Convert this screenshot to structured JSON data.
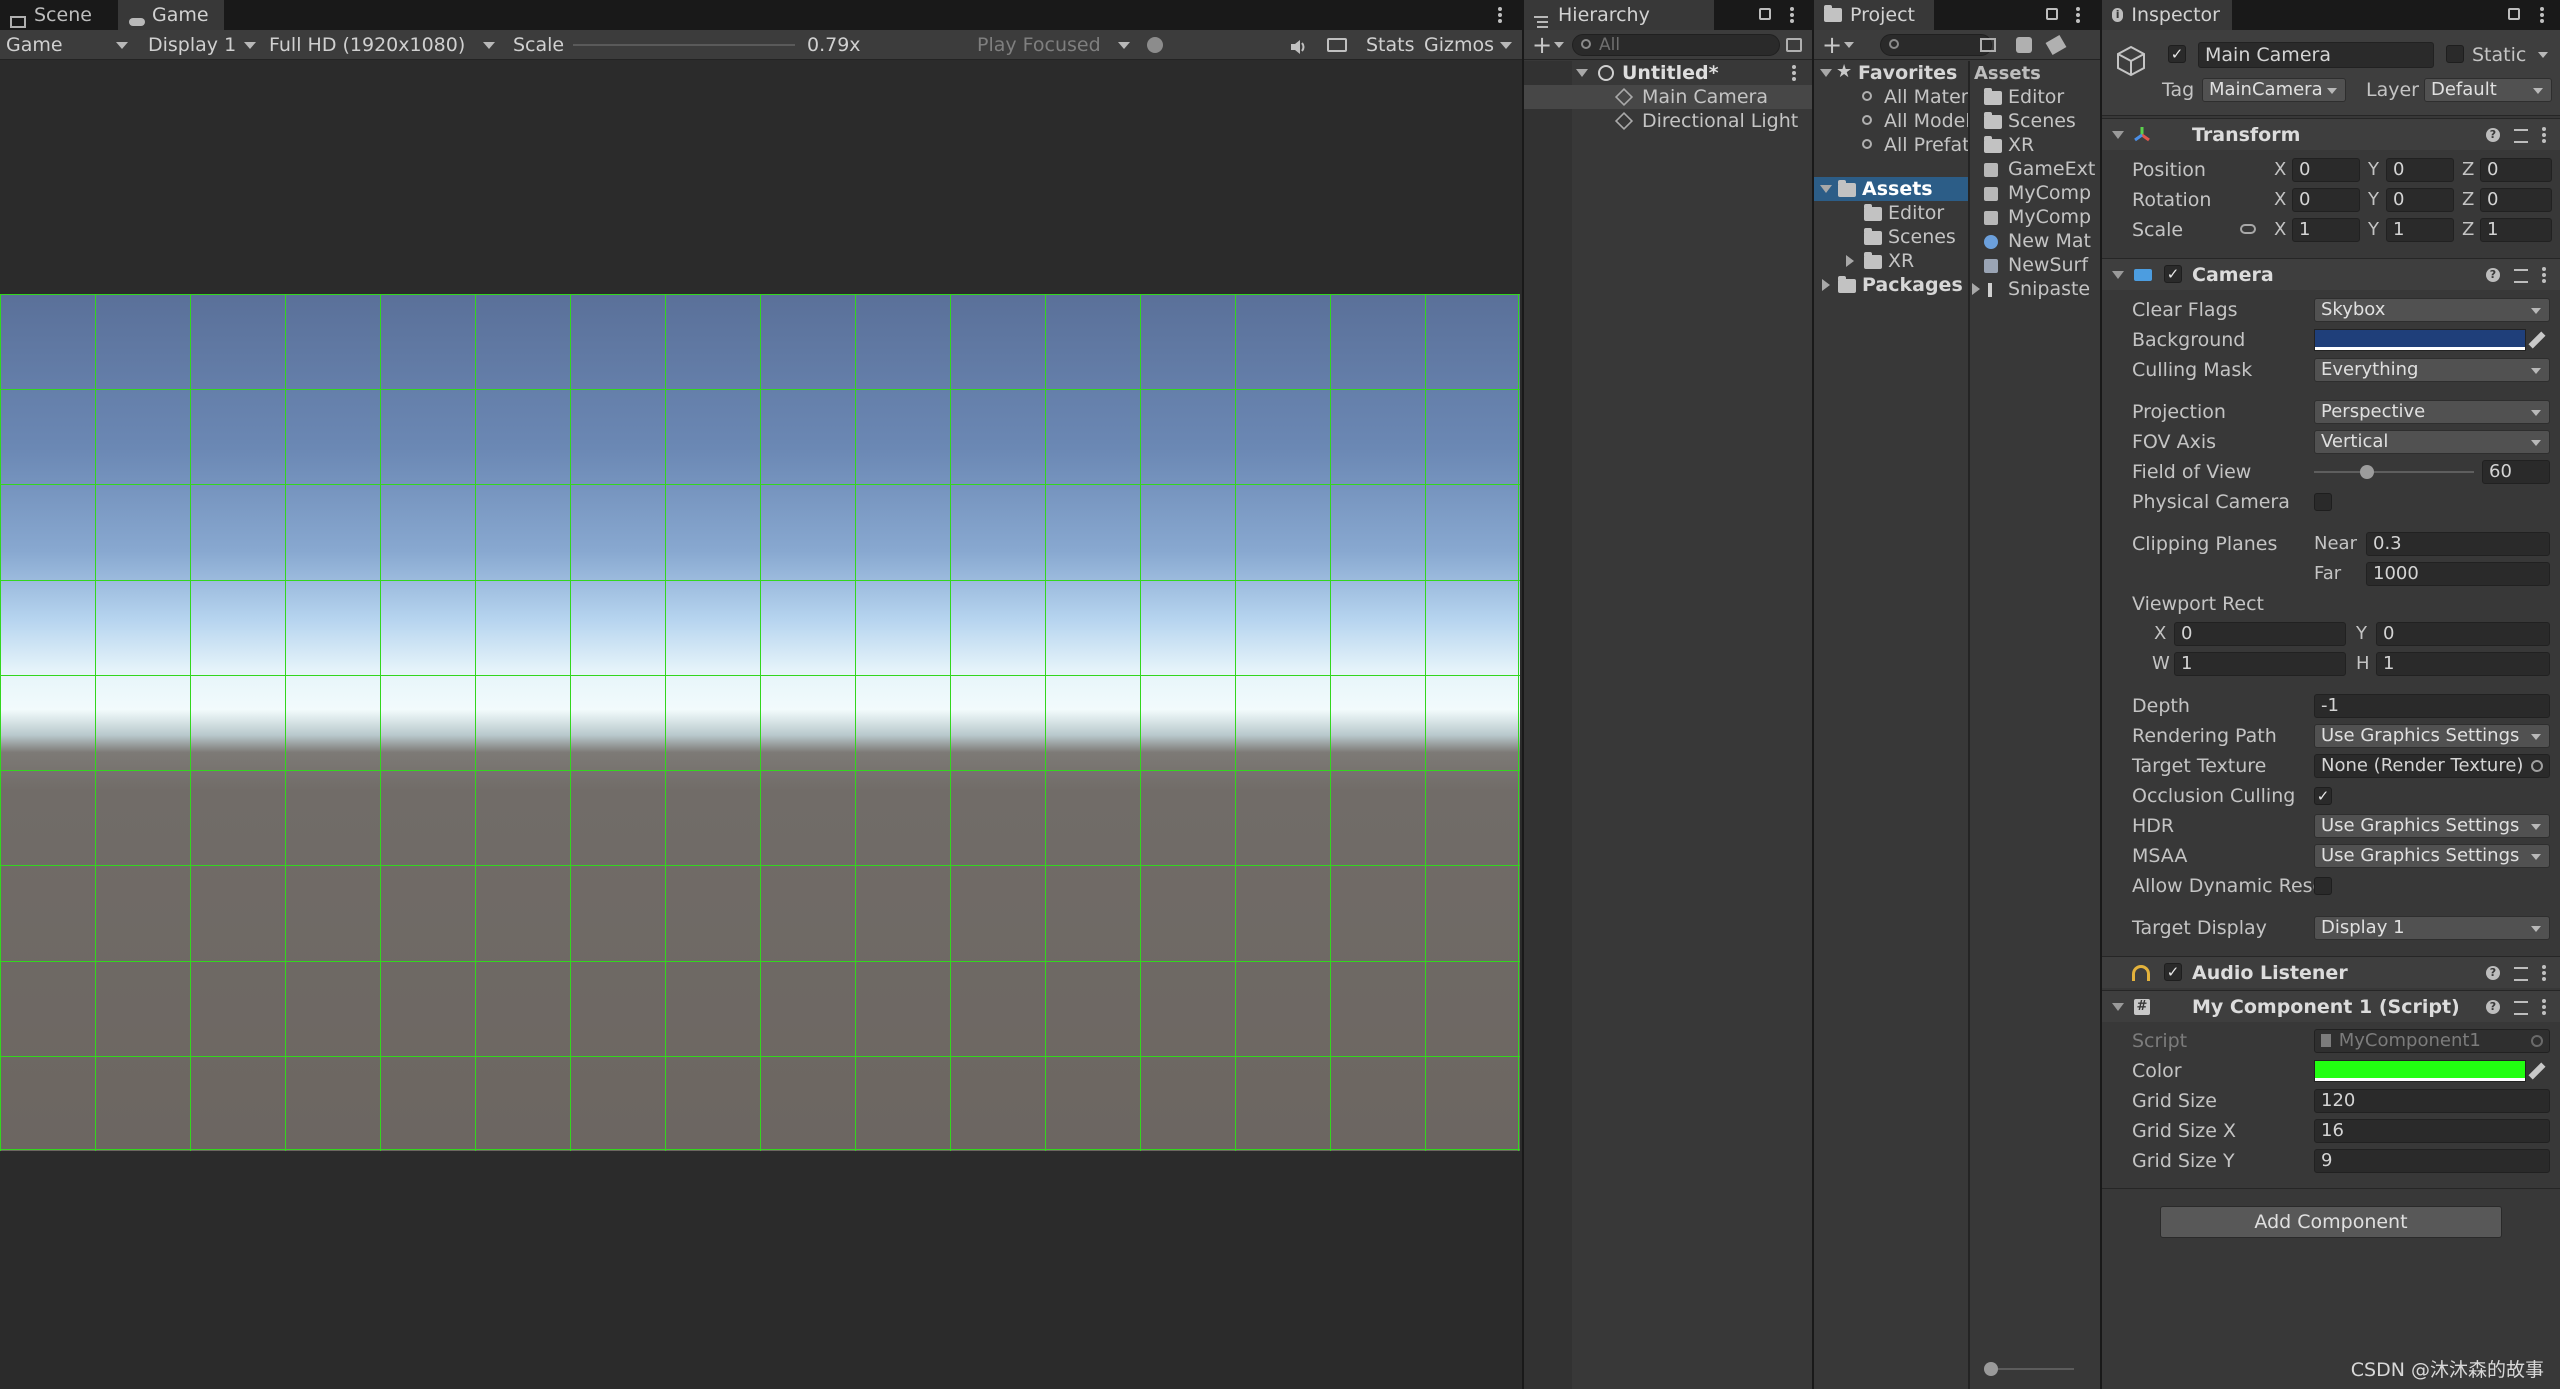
{
  "game_panel": {
    "tabs": [
      {
        "label": "Scene"
      },
      {
        "label": "Game"
      }
    ],
    "toolbar": {
      "view_select": "Game",
      "display": "Display 1",
      "resolution": "Full HD (1920x1080)",
      "scale_label": "Scale",
      "scale_value": "0.79x",
      "scale_fraction": 0.79,
      "play_mode": "Play Focused",
      "stats": "Stats",
      "gizmos": "Gizmos"
    },
    "grid": {
      "cols": 16,
      "rows": 9,
      "color": "#33d61e"
    }
  },
  "hierarchy": {
    "tab_label": "Hierarchy",
    "search_placeholder": "All",
    "scene_name": "Untitled*",
    "items": [
      {
        "label": "Main Camera"
      },
      {
        "label": "Directional Light"
      }
    ]
  },
  "project": {
    "tab_label": "Project",
    "favorites": {
      "label": "Favorites",
      "items": [
        {
          "label": "All Mater"
        },
        {
          "label": "All Model"
        },
        {
          "label": "All Prefat"
        }
      ]
    },
    "tree": {
      "assets": "Assets",
      "children": [
        {
          "label": "Editor"
        },
        {
          "label": "Scenes"
        },
        {
          "label": "XR"
        }
      ],
      "packages": "Packages"
    },
    "breadcrumb": "Assets",
    "files": [
      {
        "label": "Editor",
        "icon": "folder-icon"
      },
      {
        "label": "Scenes",
        "icon": "folder-icon"
      },
      {
        "label": "XR",
        "icon": "folder-icon"
      },
      {
        "label": "GameExt",
        "icon": "script-icon"
      },
      {
        "label": "MyComp",
        "icon": "script-icon"
      },
      {
        "label": "MyComp",
        "icon": "script-icon"
      },
      {
        "label": "New Mat",
        "icon": "material-icon"
      },
      {
        "label": "NewSurf",
        "icon": "shader-icon"
      },
      {
        "label": "Snipaste",
        "icon": "image-icon"
      }
    ]
  },
  "inspector": {
    "tab_label": "Inspector",
    "object": {
      "name": "Main Camera",
      "static_label": "Static",
      "tag_label": "Tag",
      "tag": "MainCamera",
      "layer_label": "Layer",
      "layer": "Default"
    },
    "transform": {
      "title": "Transform",
      "rows": [
        {
          "label": "Position",
          "x": "0",
          "y": "0",
          "z": "0"
        },
        {
          "label": "Rotation",
          "x": "0",
          "y": "0",
          "z": "0"
        },
        {
          "label": "Scale",
          "x": "1",
          "y": "1",
          "z": "1"
        }
      ]
    },
    "camera": {
      "title": "Camera",
      "clear_flags_label": "Clear Flags",
      "clear_flags": "Skybox",
      "background_label": "Background",
      "background_color": "#1f3f7a",
      "culling_mask_label": "Culling Mask",
      "culling_mask": "Everything",
      "projection_label": "Projection",
      "projection": "Perspective",
      "fov_axis_label": "FOV Axis",
      "fov_axis": "Vertical",
      "fov_label": "Field of View",
      "fov": "60",
      "fov_fraction": 0.33,
      "physical_label": "Physical Camera",
      "clipping_label": "Clipping Planes",
      "near_label": "Near",
      "near": "0.3",
      "far_label": "Far",
      "far": "1000",
      "viewport_label": "Viewport Rect",
      "vx": "0",
      "vy": "0",
      "vw": "1",
      "vh": "1",
      "depth_label": "Depth",
      "depth": "-1",
      "rendering_label": "Rendering Path",
      "rendering": "Use Graphics Settings",
      "target_texture_label": "Target Texture",
      "target_texture": "None (Render Texture)",
      "occlusion_label": "Occlusion Culling",
      "hdr_label": "HDR",
      "hdr": "Use Graphics Settings",
      "msaa_label": "MSAA",
      "msaa": "Use Graphics Settings",
      "dynamic_label": "Allow Dynamic Reso",
      "target_display_label": "Target Display",
      "target_display": "Display 1"
    },
    "audio_listener": {
      "title": "Audio Listener"
    },
    "my_component": {
      "title": "My Component 1 (Script)",
      "script_label": "Script",
      "script": "MyComponent1",
      "color_label": "Color",
      "color": "#22ff11",
      "grid_size_label": "Grid Size",
      "grid_size": "120",
      "grid_size_x_label": "Grid Size X",
      "grid_size_x": "16",
      "grid_size_y_label": "Grid Size Y",
      "grid_size_y": "9"
    },
    "add_component": "Add Component"
  },
  "watermark": "CSDN @沐沐森的故事"
}
